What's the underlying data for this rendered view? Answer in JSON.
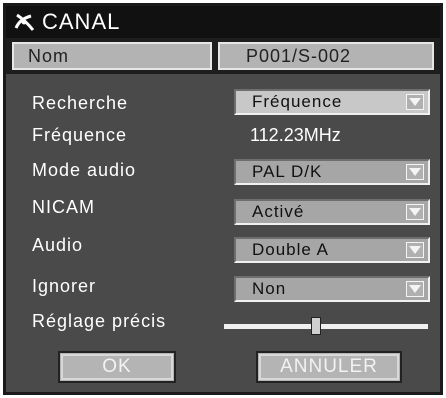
{
  "window": {
    "title": "CANAL",
    "title_icon": "satellite-dish-icon"
  },
  "name_row": {
    "label": "Nom",
    "value": "P001/S-002"
  },
  "rows": {
    "recherche": {
      "label": "Recherche",
      "value": "Fréquence"
    },
    "frequence": {
      "label": "Fréquence",
      "value": "112.23MHz"
    },
    "mode_audio": {
      "label": "Mode audio",
      "value": "PAL D/K"
    },
    "nicam": {
      "label": "NICAM",
      "value": "Activé"
    },
    "audio": {
      "label": "Audio",
      "value": "Double A"
    },
    "ignorer": {
      "label": "Ignorer",
      "value": "Non"
    },
    "reglage": {
      "label": "Réglage précis",
      "level": 0.45
    }
  },
  "buttons": {
    "ok": "OK",
    "cancel": "ANNULER"
  },
  "icons": {
    "dropdown": "chevron-down-icon"
  },
  "colors": {
    "panel": "#4a4a4a",
    "titlebar": "#111111",
    "field": "#c8c8c8",
    "button": "#b4b4b4"
  }
}
